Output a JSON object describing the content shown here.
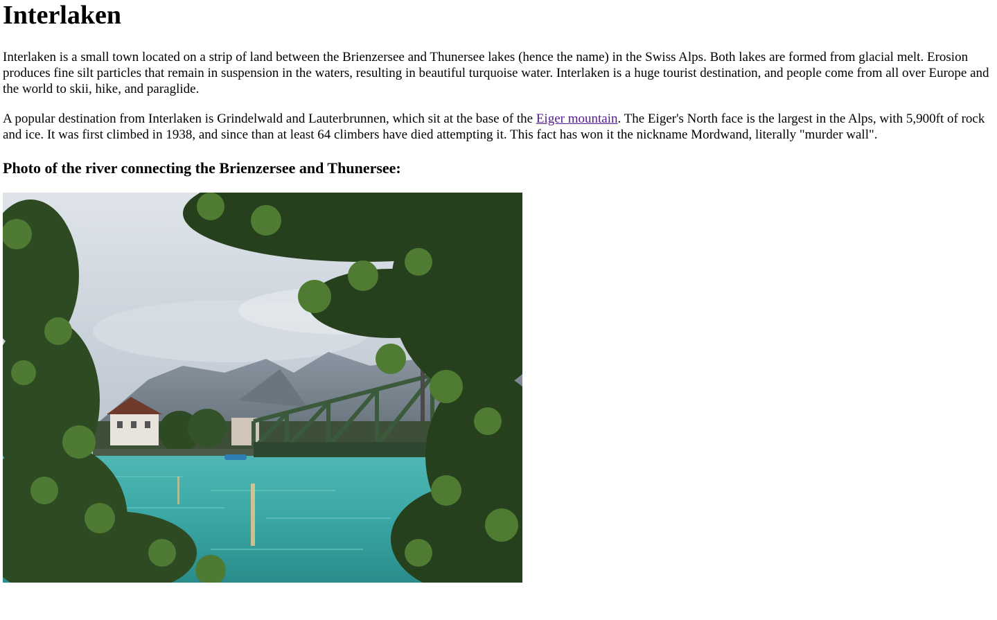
{
  "title": "Interlaken",
  "paragraph1": "Interlaken is a small town located on a strip of land between the Brienzersee and Thunersee lakes (hence the name) in the Swiss Alps. Both lakes are formed from glacial melt. Erosion produces fine silt particles that remain in suspension in the waters, resulting in beautiful turquoise water. Interlaken is a huge tourist destination, and people come from all over Europe and the world to skii, hike, and paraglide.",
  "paragraph2": {
    "before_link": "A popular destination from Interlaken is Grindelwald and Lauterbrunnen, which sit at the base of the ",
    "link_text": "Eiger mountain",
    "after_link": ". The Eiger's North face is the largest in the Alps, with 5,900ft of rock and ice. It was first climbed in 1938, and since than at least 64 climbers have died attempting it. This fact has won it the nickname Mordwand, literally \"murder wall\"."
  },
  "photo_heading": "Photo of the river connecting the Brienzersee and Thunersee:",
  "colors": {
    "link": "#551a8b",
    "water": "#3fb1ae",
    "foliage": "#2f4a23",
    "bridge": "#3b5a3c",
    "sky": "#c9d1db"
  }
}
